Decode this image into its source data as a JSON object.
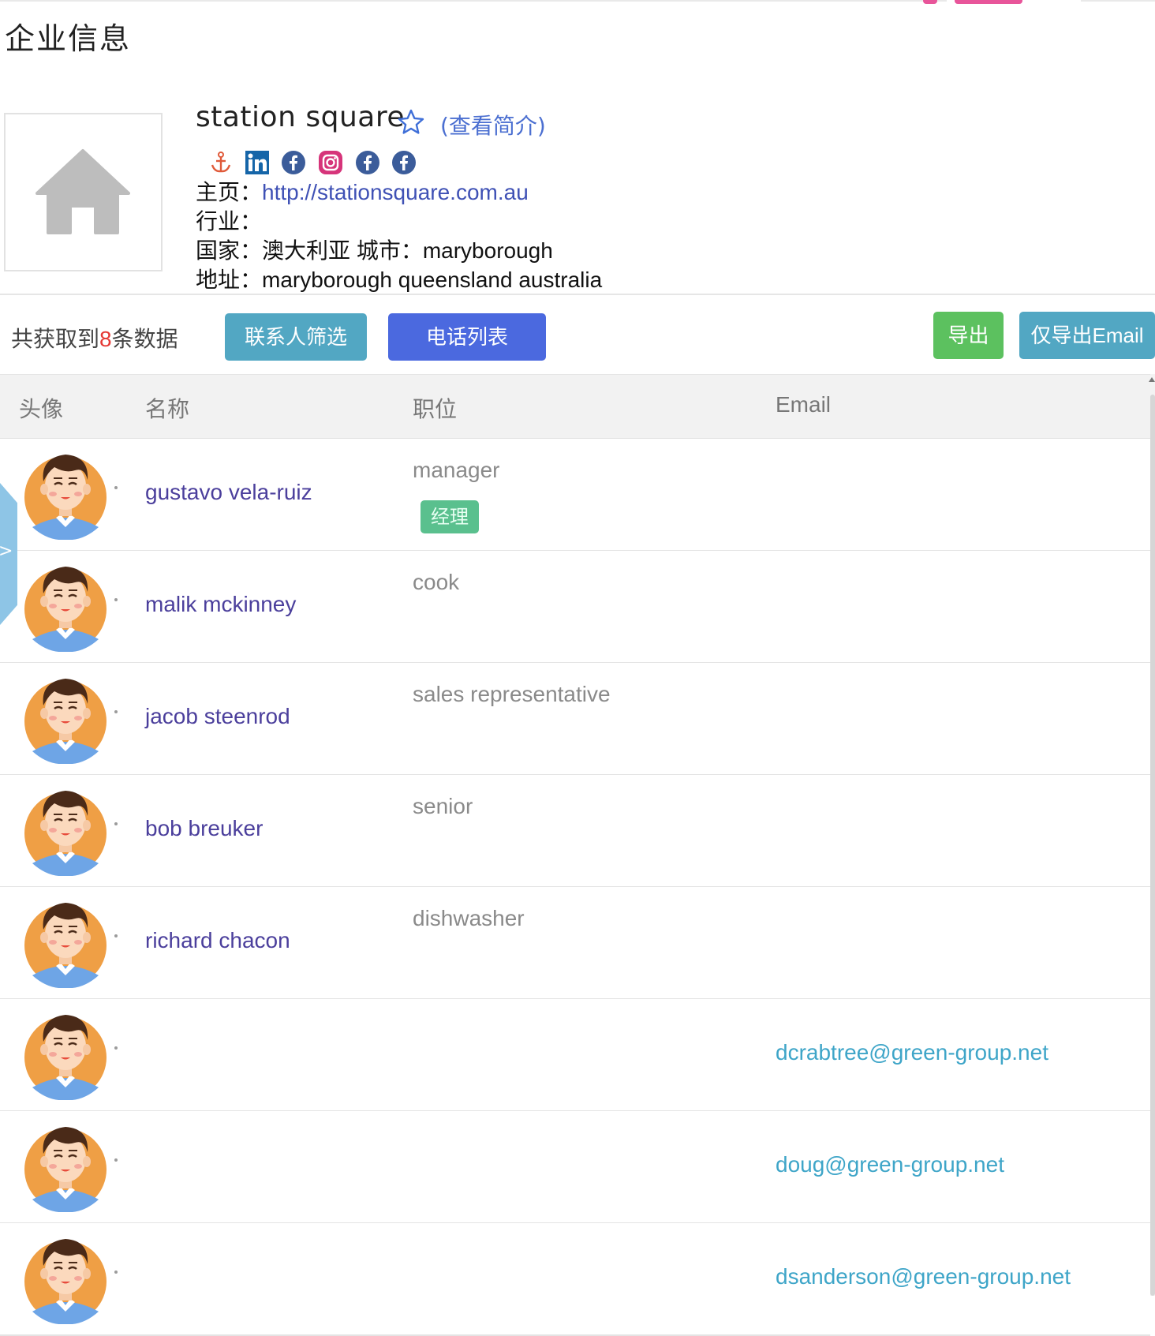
{
  "page": {
    "title": "企业信息"
  },
  "company": {
    "name": "station square",
    "view_intro": "(查看简介)",
    "homepage_label": "主页：",
    "homepage_url": "http://stationsquare.com.au",
    "industry_label": "行业：",
    "industry": "",
    "country_label": "国家：",
    "country": "澳大利亚",
    "city_label": "城市：",
    "city": "maryborough",
    "address_label": "地址：",
    "address": "maryborough queensland australia",
    "social_icons": [
      "anchor-icon",
      "linkedin-icon",
      "facebook-icon",
      "instagram-icon",
      "facebook-icon",
      "facebook-icon"
    ]
  },
  "toolbar": {
    "count_prefix": "共获取到",
    "count": "8",
    "count_suffix": "条数据",
    "filter_label": "联系人筛选",
    "phone_list_label": "电话列表",
    "export_label": "导出",
    "export_email_label": "仅导出Email"
  },
  "table": {
    "headers": {
      "avatar": "头像",
      "name": "名称",
      "position": "职位",
      "email": "Email"
    },
    "rows": [
      {
        "name": "gustavo vela-ruiz",
        "position": "manager",
        "tag": "经理",
        "email": ""
      },
      {
        "name": "malik mckinney",
        "position": "cook",
        "tag": "",
        "email": ""
      },
      {
        "name": "jacob steenrod",
        "position": "sales representative",
        "tag": "",
        "email": ""
      },
      {
        "name": "bob breuker",
        "position": "senior",
        "tag": "",
        "email": ""
      },
      {
        "name": "richard chacon",
        "position": "dishwasher",
        "tag": "",
        "email": ""
      },
      {
        "name": "",
        "position": "",
        "tag": "",
        "email": "dcrabtree@green-group.net"
      },
      {
        "name": "",
        "position": "",
        "tag": "",
        "email": "doug@green-group.net"
      },
      {
        "name": "",
        "position": "",
        "tag": "",
        "email": "dsanderson@green-group.net"
      }
    ]
  },
  "colors": {
    "link": "#3f51b5",
    "name_link": "#4b3f9c",
    "email_link": "#3ea5c8",
    "btn_teal": "#52a7c3",
    "btn_blue": "#4b69df",
    "btn_green": "#5cc15f",
    "tag_green": "#5ac08e",
    "count_red": "#e53935"
  }
}
